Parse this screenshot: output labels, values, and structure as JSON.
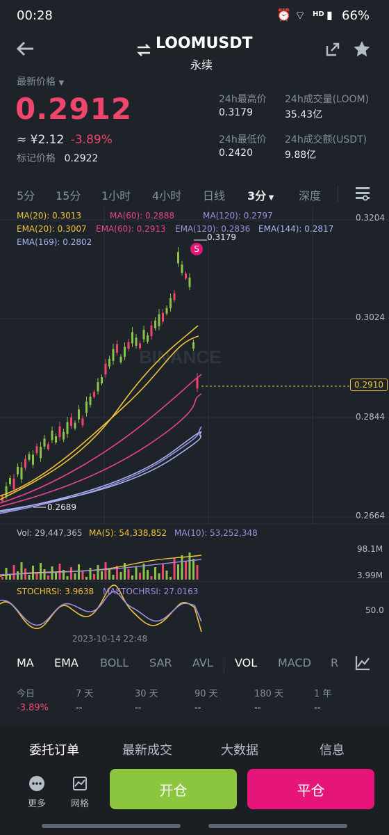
{
  "status": {
    "time": "00:28",
    "battery": "66%",
    "hd": "HD"
  },
  "header": {
    "title": "LOOMUSDT",
    "subtitle": "永续"
  },
  "price": {
    "label": "最新价格",
    "last": "0.2912",
    "cny": "≈ ¥2.12",
    "change": "-3.89%",
    "mark_label": "标记价格",
    "mark": "0.2922"
  },
  "stats": {
    "high_label": "24h最高价",
    "high": "0.3179",
    "vol_label": "24h成交量(LOOM)",
    "vol": "35.43亿",
    "low_label": "24h最低价",
    "low": "0.2420",
    "turnover_label": "24h成交额(USDT)",
    "turnover": "9.88亿"
  },
  "timeframes": [
    "5分",
    "15分",
    "1小时",
    "4小时",
    "日线",
    "3分",
    "深度"
  ],
  "ma_legend": {
    "ma20": "MA(20): 0.3013",
    "ma60": "MA(60): 0.2888",
    "ma120": "MA(120): 0.2797",
    "ema20": "EMA(20): 0.3007",
    "ema60": "EMA(60): 0.2913",
    "ema120": "EMA(120): 0.2836",
    "ema144": "EMA(144): 0.2817",
    "ema169": "EMA(169): 0.2802"
  },
  "chart": {
    "price_axis": [
      "0.3204",
      "0.3024",
      "0.2844",
      "0.2664"
    ],
    "current_tag": "0.2910",
    "high_marker": "0.3179",
    "low_marker": "0.2689",
    "watermark": "BINANCE",
    "s_marker": "S",
    "vol_label": "Vol: 29,447,365",
    "ma5": "MA(5): 54,338,852",
    "ma10": "MA(10): 53,252,348",
    "vol_axis": [
      "98.1M",
      "3.99M"
    ],
    "stoch": "STOCHRSI: 3.9638",
    "mastoch": "MASTOCHRSI: 27.0163",
    "stoch_axis": "50.0",
    "date": "2023-10-14 22:48"
  },
  "indicators": [
    "MA",
    "EMA",
    "BOLL",
    "SAR",
    "AVL",
    "VOL",
    "MACD",
    "R"
  ],
  "perf": {
    "labels": [
      "今日",
      "7 天",
      "30 天",
      "90 天",
      "180 天",
      "1 年"
    ],
    "values": [
      "-3.89%",
      "--",
      "--",
      "--",
      "--",
      "--"
    ]
  },
  "bottom_tabs": [
    "委托订单",
    "最新成交",
    "大数据",
    "信息"
  ],
  "actions": {
    "more": "更多",
    "grid": "网格",
    "open": "开仓",
    "close": "平仓"
  },
  "colors": {
    "up": "#8bc34a",
    "down": "#f0456d",
    "ma_yellow": "#f0c33c",
    "pink": "#e84393",
    "purple": "#9f8fe0",
    "lavender": "#a7b4f0",
    "open_btn": "#8cc63f",
    "close_btn": "#e5157a"
  }
}
